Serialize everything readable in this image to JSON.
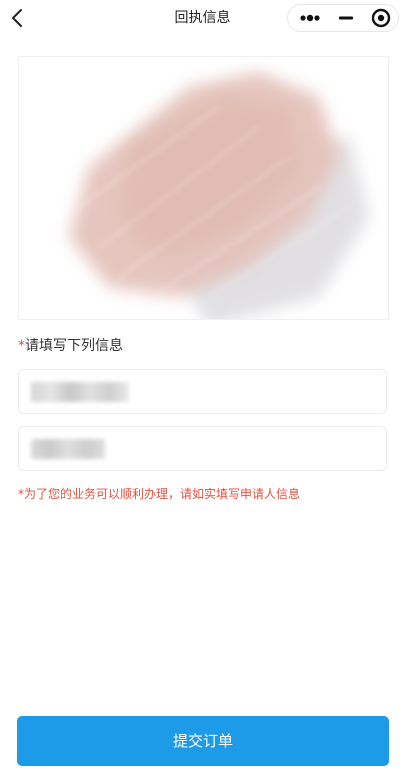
{
  "nav": {
    "title": "回执信息"
  },
  "form": {
    "required_mark": "*",
    "label": "请填写下列信息",
    "notice": "*为了您的业务可以顺利办理，请如实填写申请人信息"
  },
  "actions": {
    "submit_label": "提交订单"
  },
  "colors": {
    "accent": "#1d9be8",
    "warning": "#e15241"
  },
  "icons": [
    "back-icon",
    "more-icon",
    "minimize-icon",
    "close-icon"
  ]
}
